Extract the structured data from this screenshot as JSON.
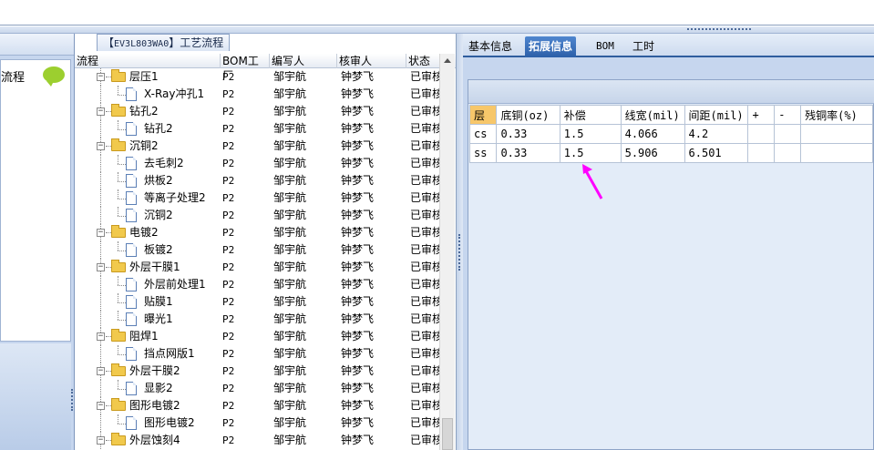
{
  "tree": {
    "tab_title_prefix": "【",
    "tab_title_code": "EV3L803WA0",
    "tab_title_suffix": "】工艺流程",
    "columns": [
      "流程",
      "BOM工厂",
      "编写人",
      "核审人",
      "状态"
    ],
    "rows": [
      {
        "level": 0,
        "type": "folder",
        "name": "层压1",
        "bom": "P2",
        "writer": "邹宇航",
        "checker": "钟梦飞",
        "state": "已审核"
      },
      {
        "level": 1,
        "type": "doc",
        "name": "X-Ray冲孔1",
        "bom": "P2",
        "writer": "邹宇航",
        "checker": "钟梦飞",
        "state": "已审核"
      },
      {
        "level": 0,
        "type": "folder",
        "name": "钻孔2",
        "bom": "P2",
        "writer": "邹宇航",
        "checker": "钟梦飞",
        "state": "已审核"
      },
      {
        "level": 1,
        "type": "doc",
        "name": "钻孔2",
        "bom": "P2",
        "writer": "邹宇航",
        "checker": "钟梦飞",
        "state": "已审核"
      },
      {
        "level": 0,
        "type": "folder",
        "name": "沉铜2",
        "bom": "P2",
        "writer": "邹宇航",
        "checker": "钟梦飞",
        "state": "已审核"
      },
      {
        "level": 1,
        "type": "doc",
        "name": "去毛刺2",
        "bom": "P2",
        "writer": "邹宇航",
        "checker": "钟梦飞",
        "state": "已审核"
      },
      {
        "level": 1,
        "type": "doc",
        "name": "烘板2",
        "bom": "P2",
        "writer": "邹宇航",
        "checker": "钟梦飞",
        "state": "已审核"
      },
      {
        "level": 1,
        "type": "doc",
        "name": "等离子处理2",
        "bom": "P2",
        "writer": "邹宇航",
        "checker": "钟梦飞",
        "state": "已审核"
      },
      {
        "level": 1,
        "type": "doc",
        "name": "沉铜2",
        "bom": "P2",
        "writer": "邹宇航",
        "checker": "钟梦飞",
        "state": "已审核"
      },
      {
        "level": 0,
        "type": "folder",
        "name": "电镀2",
        "bom": "P2",
        "writer": "邹宇航",
        "checker": "钟梦飞",
        "state": "已审核"
      },
      {
        "level": 1,
        "type": "doc",
        "name": "板镀2",
        "bom": "P2",
        "writer": "邹宇航",
        "checker": "钟梦飞",
        "state": "已审核"
      },
      {
        "level": 0,
        "type": "folder",
        "name": "外层干膜1",
        "bom": "P2",
        "writer": "邹宇航",
        "checker": "钟梦飞",
        "state": "已审核"
      },
      {
        "level": 1,
        "type": "doc",
        "name": "外层前处理1",
        "bom": "P2",
        "writer": "邹宇航",
        "checker": "钟梦飞",
        "state": "已审核"
      },
      {
        "level": 1,
        "type": "doc",
        "name": "贴膜1",
        "bom": "P2",
        "writer": "邹宇航",
        "checker": "钟梦飞",
        "state": "已审核"
      },
      {
        "level": 1,
        "type": "doc",
        "name": "曝光1",
        "bom": "P2",
        "writer": "邹宇航",
        "checker": "钟梦飞",
        "state": "已审核"
      },
      {
        "level": 0,
        "type": "folder",
        "name": "阻焊1",
        "bom": "P2",
        "writer": "邹宇航",
        "checker": "钟梦飞",
        "state": "已审核"
      },
      {
        "level": 1,
        "type": "doc",
        "name": "挡点网版1",
        "bom": "P2",
        "writer": "邹宇航",
        "checker": "钟梦飞",
        "state": "已审核"
      },
      {
        "level": 0,
        "type": "folder",
        "name": "外层干膜2",
        "bom": "P2",
        "writer": "邹宇航",
        "checker": "钟梦飞",
        "state": "已审核"
      },
      {
        "level": 1,
        "type": "doc",
        "name": "显影2",
        "bom": "P2",
        "writer": "邹宇航",
        "checker": "钟梦飞",
        "state": "已审核"
      },
      {
        "level": 0,
        "type": "folder",
        "name": "图形电镀2",
        "bom": "P2",
        "writer": "邹宇航",
        "checker": "钟梦飞",
        "state": "已审核"
      },
      {
        "level": 1,
        "type": "doc",
        "name": "图形电镀2",
        "bom": "P2",
        "writer": "邹宇航",
        "checker": "钟梦飞",
        "state": "已审核"
      },
      {
        "level": 0,
        "type": "folder",
        "name": "外层蚀刻4",
        "bom": "P2",
        "writer": "邹宇航",
        "checker": "钟梦飞",
        "state": "已审核"
      }
    ]
  },
  "left": {
    "flow_label": "流程"
  },
  "tabs": [
    "基本信息",
    "拓展信息",
    "BOM",
    "工时"
  ],
  "active_tab": 1,
  "grid": {
    "columns": [
      "层",
      "底铜(oz)",
      "补偿",
      "线宽(mil)",
      "间距(mil)",
      "+",
      "-",
      "残铜率(%)"
    ],
    "rows": [
      [
        "cs",
        "0.33",
        "1.5",
        "4.066",
        "4.2",
        "",
        "",
        ""
      ],
      [
        "ss",
        "0.33",
        "1.5",
        "5.906",
        "6.501",
        "",
        "",
        ""
      ]
    ]
  },
  "colors": {
    "arrow": "#ff00ff",
    "tab_active": "#2c5fa8",
    "folder": "#f1c94c"
  }
}
